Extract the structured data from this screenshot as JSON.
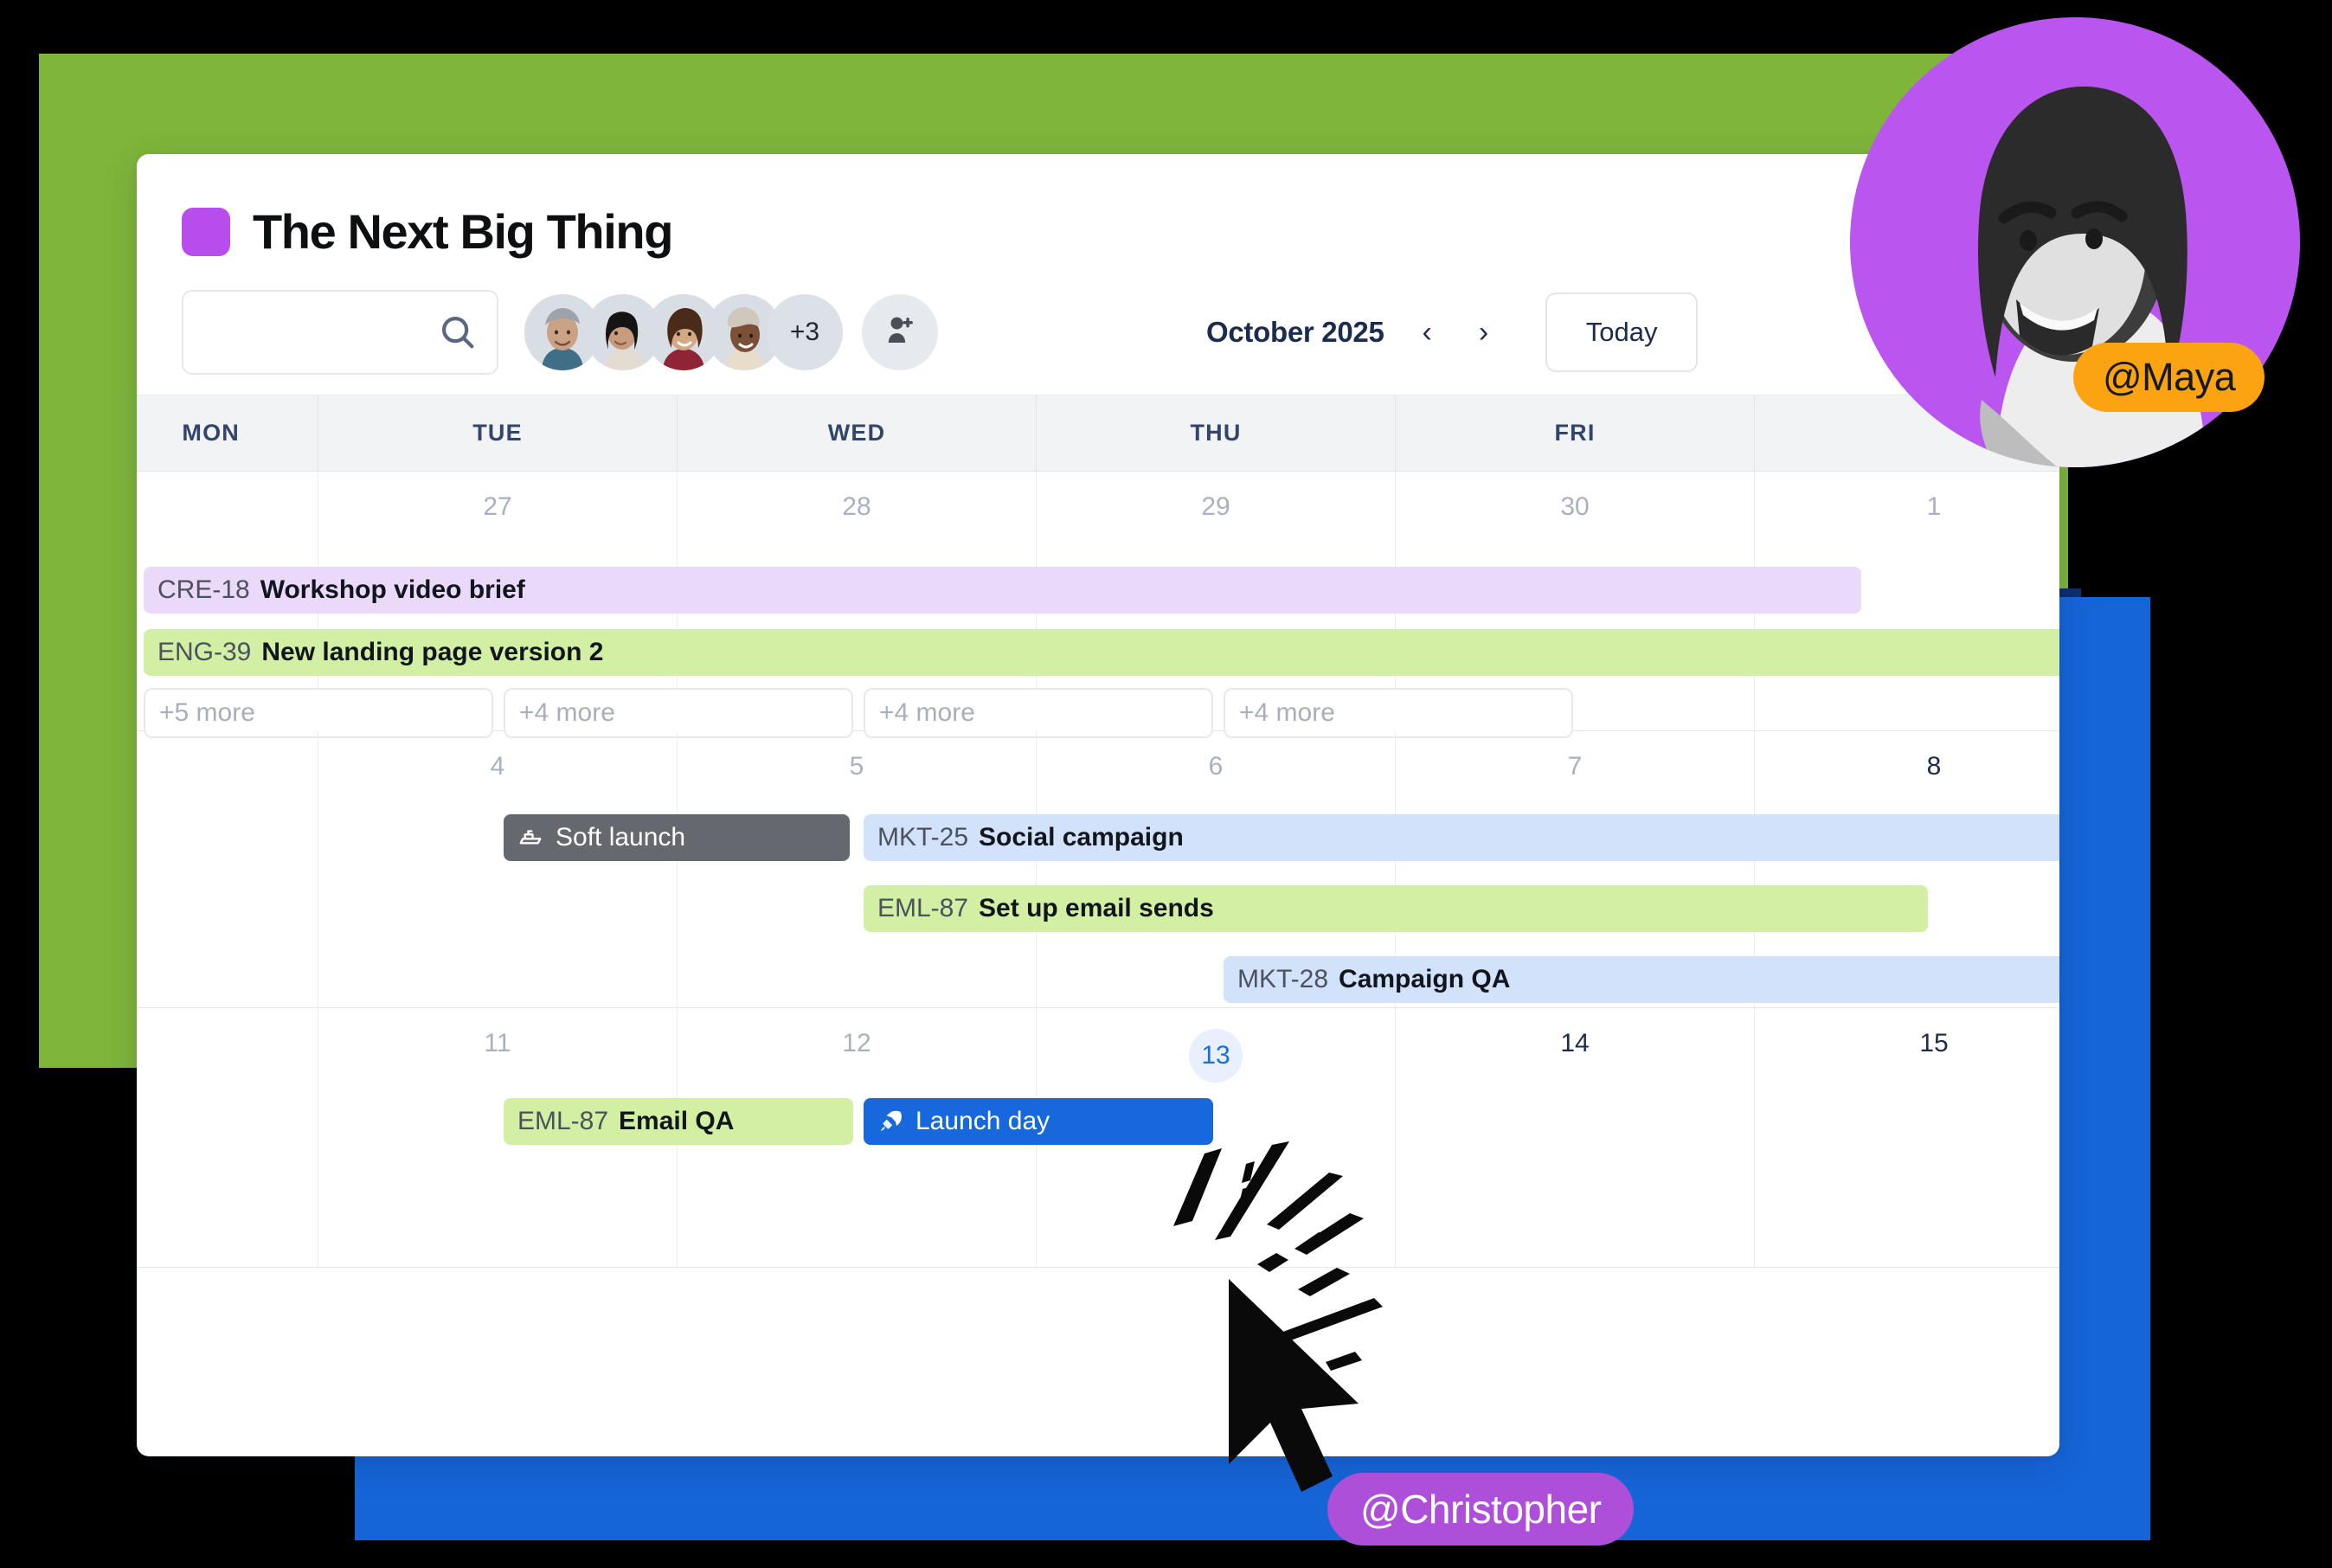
{
  "project": {
    "title": "The Next Big Thing",
    "swatch_color": "#B84DEE"
  },
  "toolbar": {
    "search_placeholder": "",
    "search_value": "",
    "search_icon": "search-icon",
    "avatar_overflow_label": "+3",
    "add_member_icon": "add-person-icon",
    "month_label": "October 2025",
    "prev_label": "‹",
    "next_label": "›",
    "today_label": "Today"
  },
  "calendar": {
    "day_headers": [
      "MON",
      "TUE",
      "WED",
      "THU",
      "FRI"
    ],
    "weeks": [
      {
        "days": [
          {
            "num": "27",
            "style": "muted"
          },
          {
            "num": "28",
            "style": "muted"
          },
          {
            "num": "29",
            "style": "muted"
          },
          {
            "num": "30",
            "style": "muted"
          },
          {
            "num": "1",
            "style": "muted"
          }
        ],
        "more": [
          "+5 more",
          "+4 more",
          "+4 more",
          "+4 more"
        ],
        "events": [
          {
            "key": "CRE-18",
            "title": "Workshop video brief",
            "color": "purple"
          },
          {
            "key": "ENG-39",
            "title": "New landing page version 2",
            "color": "green"
          }
        ]
      },
      {
        "days": [
          {
            "num": "4",
            "style": "muted"
          },
          {
            "num": "5",
            "style": "muted"
          },
          {
            "num": "6",
            "style": "muted"
          },
          {
            "num": "7",
            "style": "muted"
          },
          {
            "num": "8",
            "style": "strong"
          }
        ],
        "events": [
          {
            "key": "",
            "title": "Soft launch",
            "color": "dark",
            "icon": "ship-icon"
          },
          {
            "key": "MKT-25",
            "title": "Social campaign",
            "color": "blue"
          },
          {
            "key": "EML-87",
            "title": "Set up email sends",
            "color": "green"
          },
          {
            "key": "MKT-28",
            "title": "Campaign QA",
            "color": "blue"
          }
        ]
      },
      {
        "days": [
          {
            "num": "11",
            "style": "muted"
          },
          {
            "num": "12",
            "style": "muted"
          },
          {
            "num": "13",
            "style": "today"
          },
          {
            "num": "14",
            "style": "strong"
          },
          {
            "num": "15",
            "style": "strong"
          }
        ],
        "events": [
          {
            "key": "EML-87",
            "title": "Email QA",
            "color": "green"
          },
          {
            "key": "",
            "title": "Launch day",
            "color": "primary",
            "icon": "rocket-icon"
          }
        ]
      }
    ]
  },
  "personas": [
    {
      "name": "@Maya",
      "badge_color": "#FCA311",
      "ring_color": "#BB55F0"
    },
    {
      "name": "@Christopher",
      "badge_color": "#AD4FD8"
    }
  ],
  "decor": {
    "green_card": "#7FB53B",
    "navy_card": "#0B3070",
    "blue_card": "#1565D8",
    "cursor_icon": "mouse-pointer-icon",
    "click_burst_icon": "click-burst-icon"
  }
}
